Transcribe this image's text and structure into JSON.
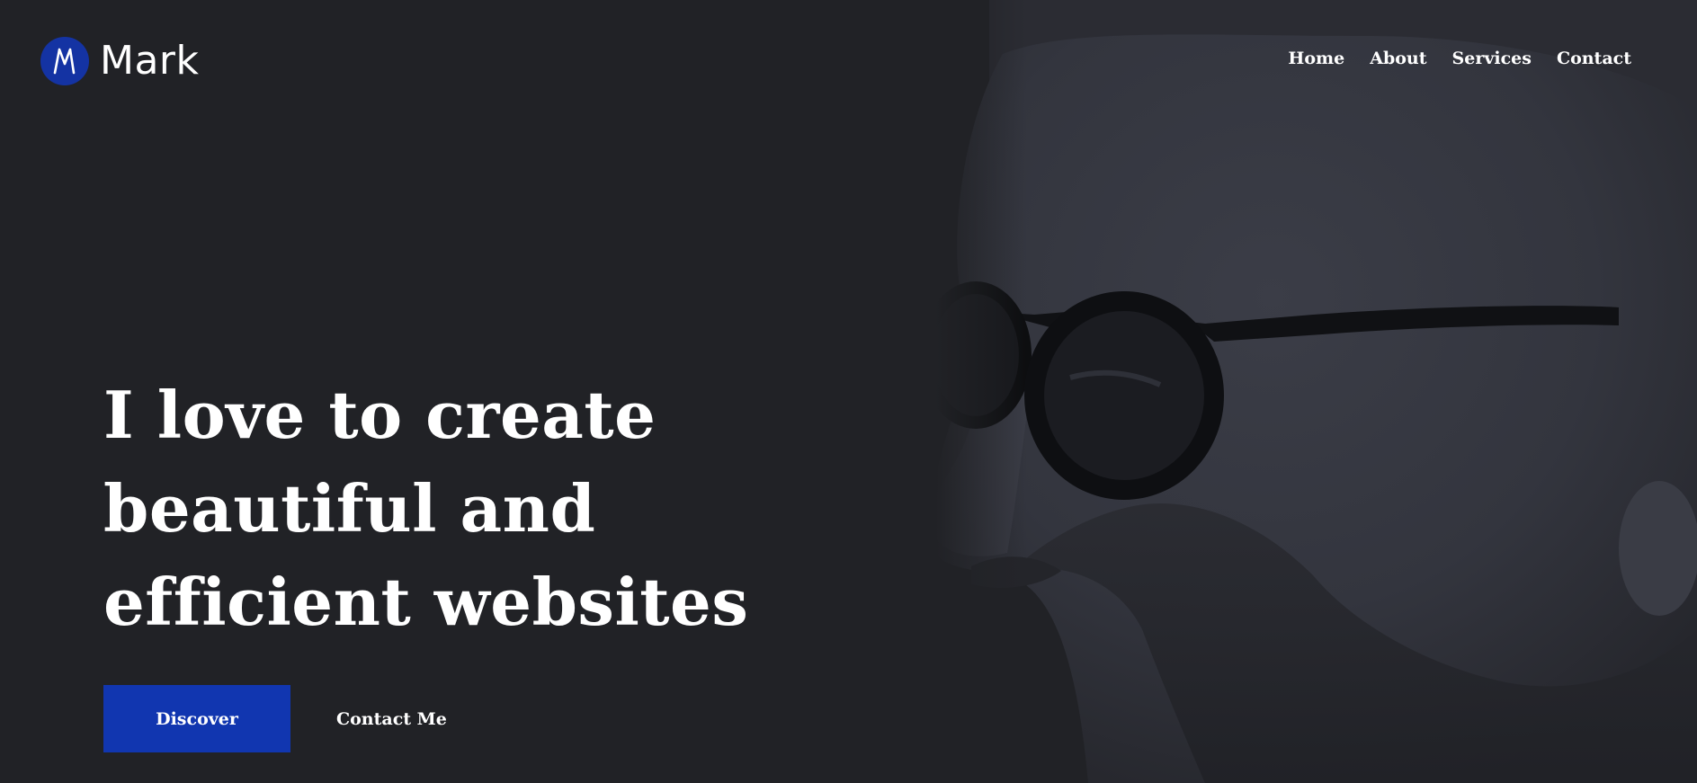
{
  "brand": {
    "logo_letter": "M",
    "name": "Mark",
    "accent_color": "#1136b0"
  },
  "nav": {
    "items": [
      {
        "label": "Home"
      },
      {
        "label": "About"
      },
      {
        "label": "Services"
      },
      {
        "label": "Contact"
      }
    ]
  },
  "hero": {
    "headline_lines": [
      "I love to create",
      "beautiful and",
      "efficient websites"
    ],
    "primary_button": "Discover",
    "secondary_button": "Contact Me",
    "background_color": "#212226"
  },
  "icons": {
    "logo": "m-logo-icon",
    "portrait": "portrait-image"
  }
}
